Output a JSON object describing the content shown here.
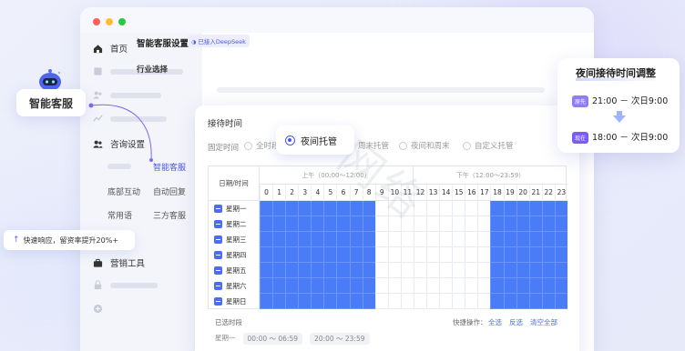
{
  "window": {
    "dots": [
      "#ff5f57",
      "#febc2e",
      "#28c840"
    ]
  },
  "sidebar": {
    "home": "首页",
    "consult": "咨询设置",
    "sub_smart": "智能客服",
    "sub_bottom": "底部互动",
    "sub_auto": "自动回复",
    "sub_common": "常用语",
    "sub_third": "三方客服",
    "marketing": "营销工具"
  },
  "header": {
    "title": "智能客服设置",
    "badge": "已接入DeepSeek",
    "industry": "行业选择"
  },
  "panel": {
    "title": "接待时间",
    "fixed_label": "固定时间",
    "options": [
      "全时段",
      "夜间托管",
      "周末托管",
      "夜间和周末",
      "自定义托管"
    ],
    "col_date": "日期/时间",
    "am_label": "上午（00:00～12:00）",
    "pm_label": "下午（12:00～23:59）",
    "hours": [
      "0",
      "1",
      "2",
      "3",
      "4",
      "5",
      "6",
      "7",
      "8",
      "9",
      "10",
      "11",
      "12",
      "13",
      "14",
      "15",
      "16",
      "17",
      "18",
      "19",
      "20",
      "21",
      "22",
      "23"
    ],
    "days": [
      "星期一",
      "星期二",
      "星期三",
      "星期四",
      "星期五",
      "星期六",
      "星期日"
    ],
    "selected_label": "已选时段",
    "quick_label": "快捷操作：",
    "quick_all": "全选",
    "quick_invert": "反选",
    "quick_clear": "清空全部",
    "row1_day": "星期一",
    "row1_chip1": "00:00 ～ 06:59",
    "row1_chip2": "20:00 ～ 23:59"
  },
  "night_popup": {
    "label": "夜间托管"
  },
  "right_card": {
    "title": "夜间接待时间调整",
    "old_tag": "原先",
    "old_time": "21:00 － 次日9:00",
    "new_tag": "现在",
    "new_time": "18:00 － 次日9:00"
  },
  "bot": {
    "label": "智能客服"
  },
  "toast": {
    "text": "快速响应，留资率提升20%+"
  },
  "colors": {
    "accent": "#4a55e8",
    "cell_on": "#4a7cf7",
    "old_tag": "#8f7cf7",
    "new_tag": "#7b5cf5"
  }
}
